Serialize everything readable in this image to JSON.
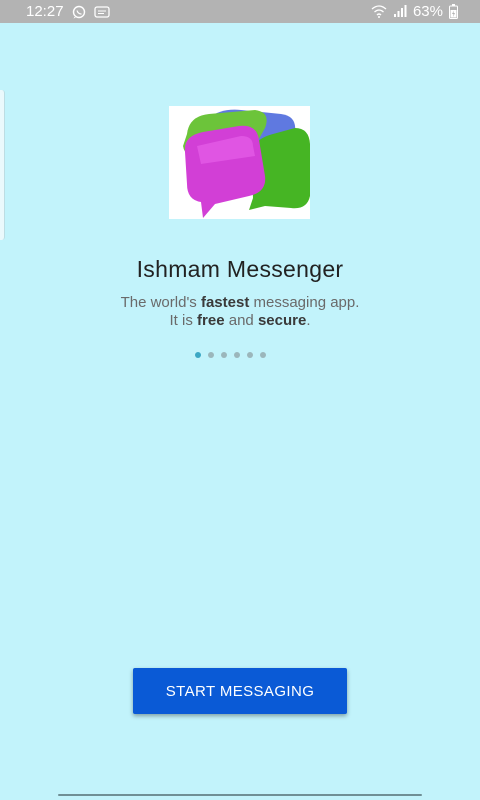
{
  "status_bar": {
    "time": "12:27",
    "battery_percent": "63%",
    "icons": [
      "whatsapp-icon",
      "message-icon",
      "wifi-icon",
      "signal-icon",
      "battery-icon"
    ]
  },
  "onboarding": {
    "app_name": "Ishmam Messenger",
    "subtitle_parts": {
      "p1": "The world's ",
      "p2": "fastest",
      "p3": " messaging app.",
      "p4": "It is ",
      "p5": "free",
      "p6": " and ",
      "p7": "secure",
      "p8": "."
    },
    "page_count": 6,
    "active_page": 1
  },
  "actions": {
    "start_label": "START MESSAGING"
  },
  "colors": {
    "background": "#c2f3fb",
    "button": "#0a5ad6",
    "status_bar": "#b3b3b3"
  }
}
